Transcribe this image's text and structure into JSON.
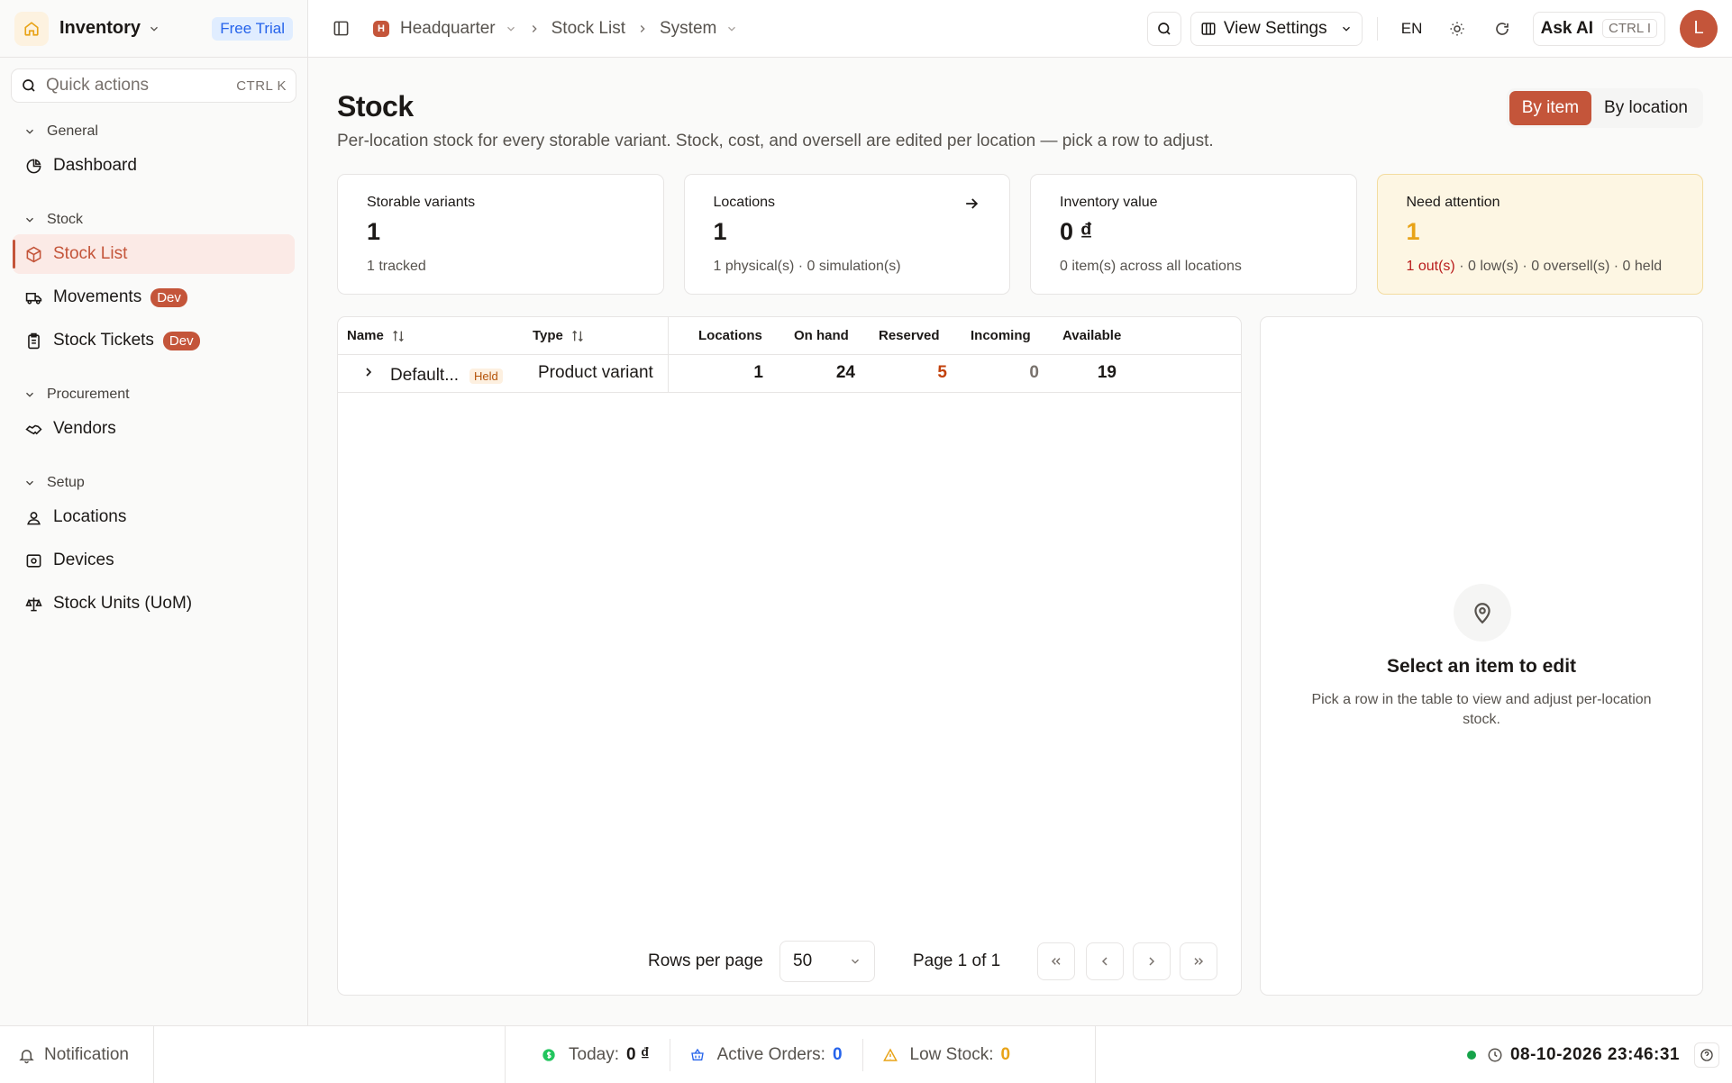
{
  "colors": {
    "accent": "#c4553a",
    "warn_bg": "#fdf6e3",
    "amber": "#e8a317",
    "link_blue": "#2563eb",
    "danger": "#b91c1c",
    "online": "#16a34a"
  },
  "sidebar": {
    "app_name": "Inventory",
    "trial_badge": "Free Trial",
    "quick_actions": {
      "placeholder": "Quick actions",
      "shortcut": "CTRL K"
    },
    "groups": [
      {
        "label": "General",
        "items": [
          {
            "label": "Dashboard",
            "icon": "pie-chart-icon"
          }
        ]
      },
      {
        "label": "Stock",
        "items": [
          {
            "label": "Stock List",
            "icon": "package-icon",
            "active": true
          },
          {
            "label": "Movements",
            "icon": "truck-icon",
            "badge": "Dev"
          },
          {
            "label": "Stock Tickets",
            "icon": "clipboard-icon",
            "badge": "Dev"
          }
        ]
      },
      {
        "label": "Procurement",
        "items": [
          {
            "label": "Vendors",
            "icon": "handshake-icon"
          }
        ]
      },
      {
        "label": "Setup",
        "items": [
          {
            "label": "Locations",
            "icon": "map-pin-user-icon"
          },
          {
            "label": "Devices",
            "icon": "device-icon"
          },
          {
            "label": "Stock Units (UoM)",
            "icon": "scale-icon"
          }
        ]
      }
    ]
  },
  "topbar": {
    "breadcrumb": {
      "org_initial": "H",
      "org": "Headquarter",
      "page": "Stock List",
      "context": "System"
    },
    "view_settings": "View Settings",
    "language": "EN",
    "ask_ai": {
      "label": "Ask AI",
      "shortcut": "CTRL I"
    },
    "avatar_initial": "L"
  },
  "main": {
    "title": "Stock",
    "subtitle": "Per-location stock for every storable variant. Stock, cost, and oversell are edited per location — pick a row to adjust.",
    "view_toggle": {
      "by_item": "By item",
      "by_location": "By location",
      "selected": "by_item"
    },
    "cards": {
      "storable": {
        "label": "Storable variants",
        "value": "1",
        "sub": "1 tracked"
      },
      "locations": {
        "label": "Locations",
        "value": "1",
        "sub": "1 physical(s) · 0 simulation(s)"
      },
      "inventory": {
        "label": "Inventory value",
        "value": "0 ₫",
        "sub": "0 item(s) across all locations"
      },
      "attention": {
        "label": "Need attention",
        "value": "1",
        "out": "1 out(s)",
        "rest": " · 0 low(s) · 0 oversell(s) · 0 held"
      }
    },
    "table": {
      "columns": {
        "name": "Name",
        "type": "Type",
        "locations": "Locations",
        "on_hand": "On hand",
        "reserved": "Reserved",
        "incoming": "Incoming",
        "available": "Available"
      },
      "rows": [
        {
          "name": "Default...",
          "badge": "Held",
          "type": "Product variant",
          "locations": "1",
          "on_hand": "24",
          "reserved": "5",
          "incoming": "0",
          "available": "19"
        }
      ],
      "rows_per_page_label": "Rows per page",
      "rows_per_page": "50",
      "page_info": "Page 1 of 1"
    },
    "detail": {
      "empty_title": "Select an item to edit",
      "empty_sub": "Pick a row in the table to view and adjust per-location stock."
    }
  },
  "footer": {
    "notification": "Notification",
    "today": {
      "label": "Today:",
      "value": "0 ₫"
    },
    "active_orders": {
      "label": "Active Orders:",
      "value": "0"
    },
    "low_stock": {
      "label": "Low Stock:",
      "value": "0"
    },
    "datetime": "08-10-2026 23:46:31"
  }
}
